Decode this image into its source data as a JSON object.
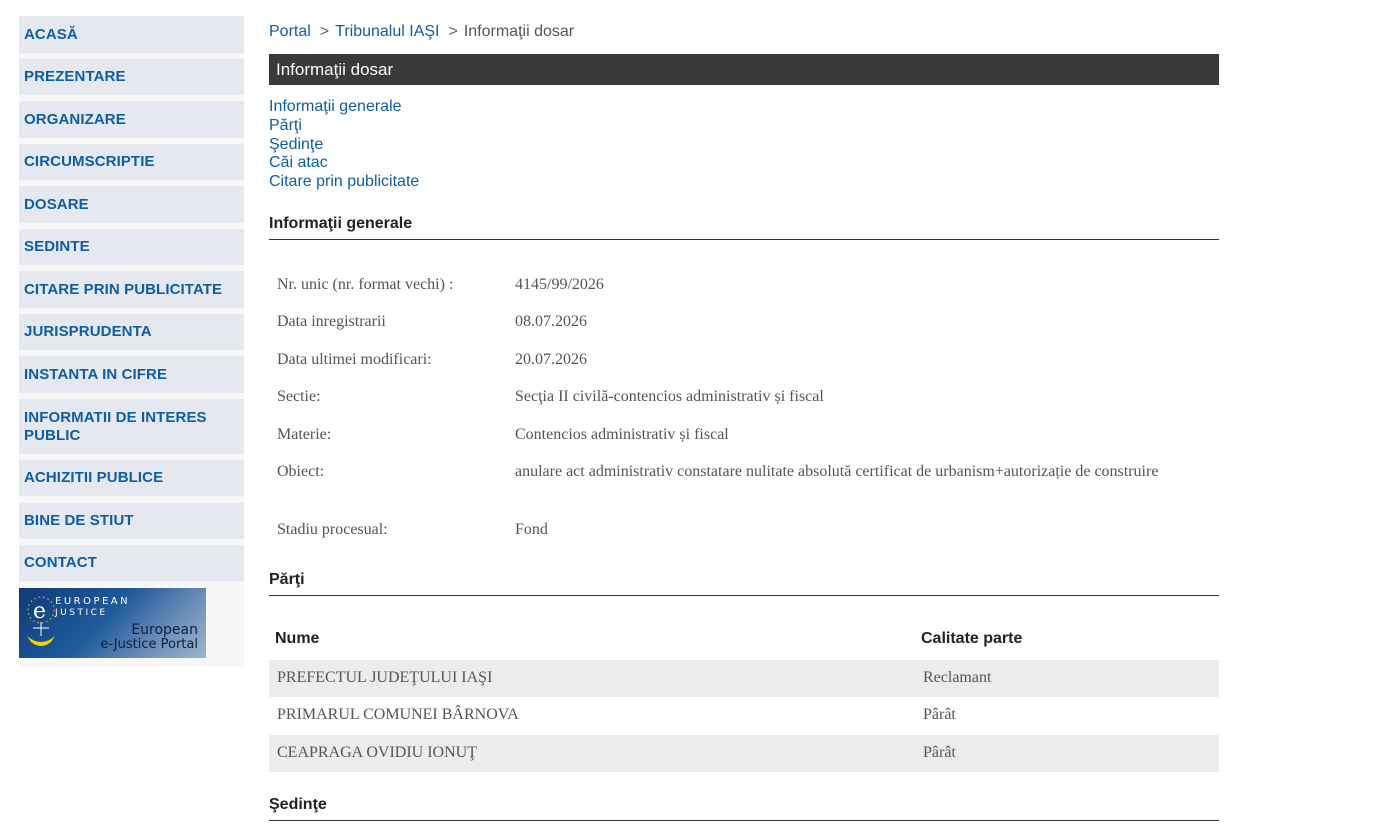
{
  "sidebar": {
    "items": [
      {
        "label": "ACASĂ"
      },
      {
        "label": "PREZENTARE"
      },
      {
        "label": "ORGANIZARE"
      },
      {
        "label": "CIRCUMSCRIPTIE"
      },
      {
        "label": "DOSARE"
      },
      {
        "label": "SEDINTE"
      },
      {
        "label": "CITARE PRIN PUBLICITATE"
      },
      {
        "label": "JURISPRUDENTA"
      },
      {
        "label": "INSTANTA IN CIFRE"
      },
      {
        "label": "INFORMATII DE INTERES PUBLIC"
      },
      {
        "label": "ACHIZITII PUBLICE"
      },
      {
        "label": "BINE DE STIUT"
      },
      {
        "label": "CONTACT"
      }
    ],
    "banner": {
      "line1": "EUROPEAN",
      "line2": "JUSTICE",
      "caption1": "European",
      "caption2": "e-Justice Portal"
    }
  },
  "breadcrumb": {
    "portal": "Portal",
    "court": "Tribunalul IAŞI",
    "current": "Informaţii dosar",
    "sep": ">"
  },
  "title": "Informaţii dosar",
  "toc": [
    "Informaţii generale",
    "Părţi",
    "Şedinţe",
    "Căi atac",
    "Citare prin publicitate"
  ],
  "general": {
    "heading": "Informaţii generale",
    "rows": [
      {
        "label": "Nr. unic (nr. format vechi) :",
        "value": "4145/99/2026"
      },
      {
        "label": "Data inregistrarii",
        "value": "08.07.2026"
      },
      {
        "label": "Data ultimei modificari:",
        "value": "20.07.2026"
      },
      {
        "label": "Sectie:",
        "value": "Secţia II civilă-contencios administrativ și fiscal"
      },
      {
        "label": "Materie:",
        "value": "Contencios administrativ și fiscal"
      },
      {
        "label": "Obiect:",
        "value": "anulare act administrativ constatare nulitate absolută certificat de urbanism+autorizație de construire"
      },
      {
        "label": "Stadiu procesual:",
        "value": "Fond"
      }
    ]
  },
  "parties": {
    "heading": "Părţi",
    "columns": [
      "Nume",
      "Calitate parte"
    ],
    "rows": [
      {
        "name": "PREFECTUL JUDEŢULUI IAŞI",
        "role": "Reclamant"
      },
      {
        "name": "PRIMARUL COMUNEI BÂRNOVA",
        "role": "Pârât"
      },
      {
        "name": "CEAPRAGA OVIDIU IONUŢ",
        "role": "Pârât"
      }
    ]
  },
  "hearings": {
    "heading": "Şedinţe"
  },
  "colors": {
    "link": "#0e5ea7",
    "nav_bg": "#e5e8ee",
    "title_bg": "#3a3a3a",
    "row_shade": "#ececec"
  }
}
